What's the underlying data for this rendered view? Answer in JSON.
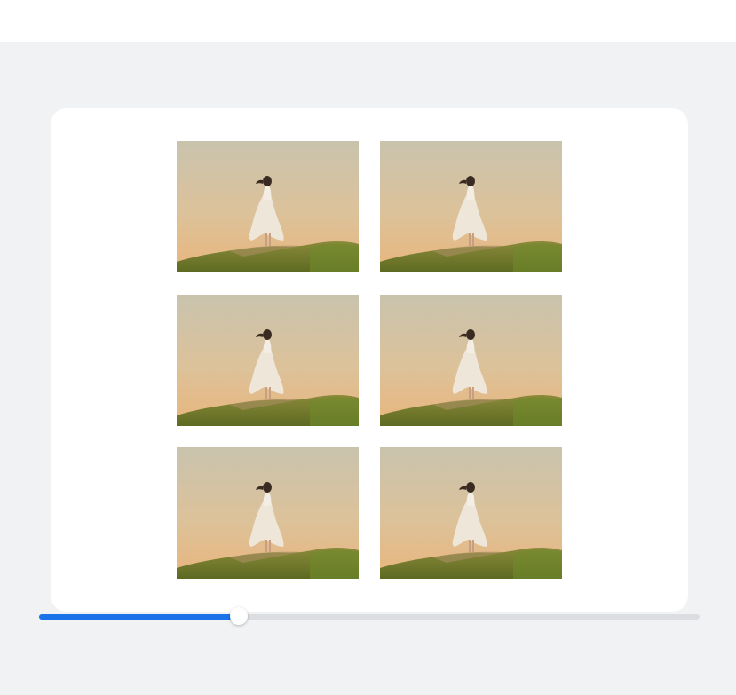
{
  "gallery": {
    "photos": [
      {
        "alt": "woman-on-hill-photo"
      },
      {
        "alt": "woman-on-hill-photo"
      },
      {
        "alt": "woman-on-hill-photo"
      },
      {
        "alt": "woman-on-hill-photo"
      },
      {
        "alt": "woman-on-hill-photo"
      },
      {
        "alt": "woman-on-hill-photo"
      }
    ]
  },
  "slider": {
    "value_fraction": 0.303,
    "fill_color": "#1a73e8",
    "track_color": "#dcdde0"
  }
}
